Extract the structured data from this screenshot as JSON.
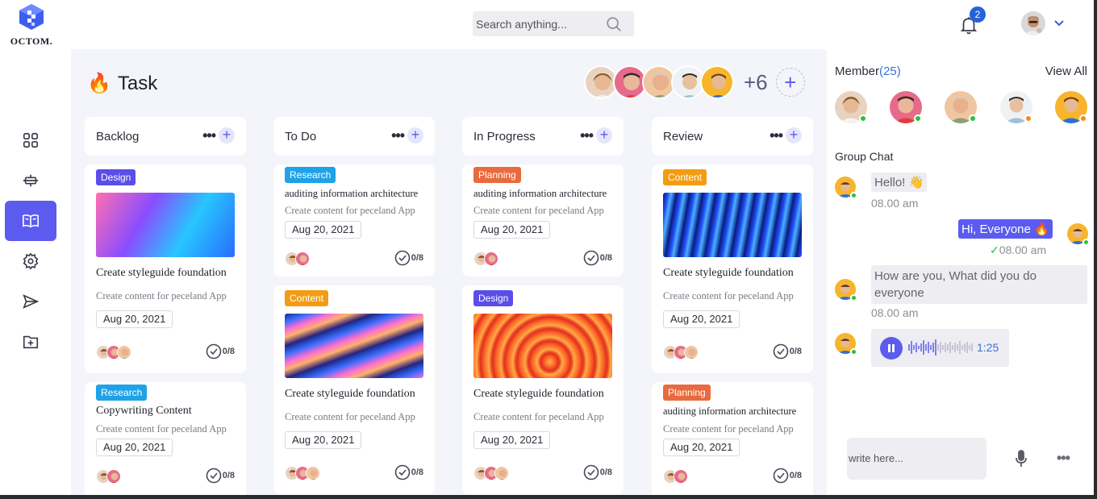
{
  "app": {
    "logo_text": "OCTOM."
  },
  "search": {
    "placeholder": "Search anything..."
  },
  "notifications": {
    "count": "2"
  },
  "sidebar": {
    "items": [
      {
        "name": "dashboard-grid-icon",
        "active": false
      },
      {
        "name": "layout-icon",
        "active": false
      },
      {
        "name": "book-icon",
        "active": true
      },
      {
        "name": "settings-gear-icon",
        "active": false
      },
      {
        "name": "send-icon",
        "active": false
      },
      {
        "name": "folder-add-icon",
        "active": false
      }
    ]
  },
  "main": {
    "title": "Task",
    "title_emoji": "🔥",
    "team_more": "+6",
    "columns": [
      {
        "title": "Backlog",
        "cards": [
          {
            "tag": "Design",
            "tag_type": "design",
            "title": "Create styleguide foundation",
            "subtitle": "Create content for peceland App",
            "date": "Aug 20, 2021",
            "progress": "0/8"
          },
          {
            "tag": "Research",
            "tag_type": "research",
            "title": "Copywriting Content",
            "subtitle": "Create content for peceland App",
            "date": "Aug 20, 2021",
            "progress": "0/8"
          }
        ]
      },
      {
        "title": "To Do",
        "cards": [
          {
            "tag": "Research",
            "tag_type": "research",
            "title": "auditing information architecture",
            "subtitle": "Create content for peceland App",
            "date": "Aug 20, 2021",
            "progress": "0/8"
          },
          {
            "tag": "Content",
            "tag_type": "content",
            "title": "Create styleguide foundation",
            "subtitle": "Create content for peceland App",
            "date": "Aug 20, 2021",
            "progress": "0/8"
          }
        ]
      },
      {
        "title": "In Progress",
        "cards": [
          {
            "tag": "Planning",
            "tag_type": "planning",
            "title": "auditing information architecture",
            "subtitle": "Create content for peceland App",
            "date": "Aug 20, 2021",
            "progress": "0/8"
          },
          {
            "tag": "Design",
            "tag_type": "design",
            "title": "Create styleguide foundation",
            "subtitle": "Create content for peceland App",
            "date": "Aug 20, 2021",
            "progress": "0/8"
          }
        ]
      },
      {
        "title": "Review",
        "cards": [
          {
            "tag": "Content",
            "tag_type": "content",
            "title": "Create styleguide foundation",
            "subtitle": "Create content for peceland App",
            "date": "Aug 20, 2021",
            "progress": "0/8"
          },
          {
            "tag": "Planning",
            "tag_type": "planning",
            "title": "auditing information architecture",
            "subtitle": "Create content for peceland App",
            "date": "Aug 20, 2021",
            "progress": "0/8"
          }
        ]
      }
    ]
  },
  "panel": {
    "member_label": "Member",
    "member_count": "(25)",
    "view_all": "View All",
    "group_chat": "Group Chat",
    "messages": [
      {
        "text": "Hello! 👋",
        "time": "08.00 am",
        "from": "other"
      },
      {
        "text": "Hi, Everyone 🔥",
        "time": "08.00 am",
        "from": "me"
      },
      {
        "text": "How are you, What did you do everyone",
        "time": "08.00 am",
        "from": "other"
      }
    ],
    "voice_duration": "1:25",
    "write_placeholder": "write here..."
  },
  "colors": {
    "accent": "#5b5bf0",
    "design_tag": "#5b4de8",
    "research_tag": "#1ea2e8",
    "planning_tag": "#e96a3e",
    "content_tag": "#f39c12",
    "online": "#27c23f",
    "away": "#f08a26"
  }
}
